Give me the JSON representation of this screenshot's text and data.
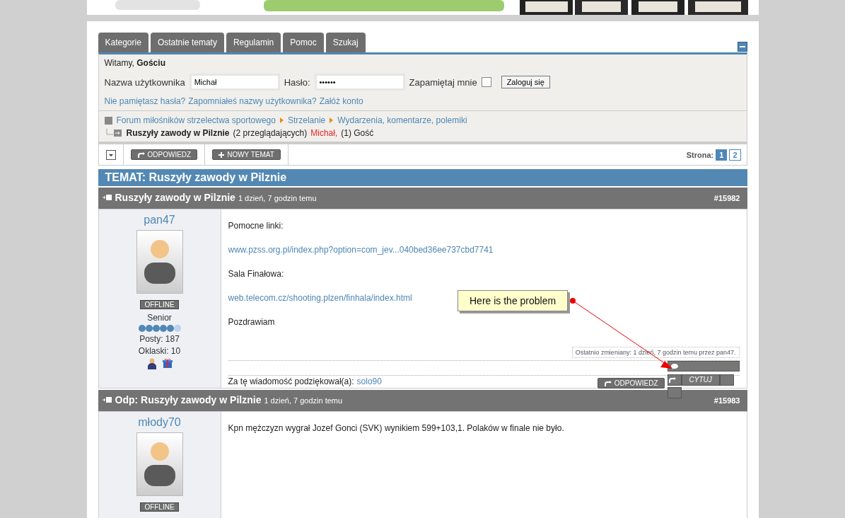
{
  "tabs": [
    {
      "label": "Kategorie"
    },
    {
      "label": "Ostatnie tematy"
    },
    {
      "label": "Regulamin"
    },
    {
      "label": "Pomoc"
    },
    {
      "label": "Szukaj"
    }
  ],
  "login": {
    "greeting": "Witamy, **Gościu**",
    "username_label": "Nazwa użytkownika",
    "username": "Michał",
    "password_label": "Hasło:",
    "password": "••••••",
    "remember_label": "Zapamiętaj mnie",
    "remember": false,
    "submit": "Zaloguj się",
    "links": [
      {
        "label": "Nie pamiętasz hasła?"
      },
      {
        "label": "Zapomniałeś nazwy użytkownika?"
      },
      {
        "label": "Załóż konto"
      }
    ]
  },
  "breadcrumb": [
    "Forum miłośników strzelectwa sportowego",
    "Strzelanie",
    "Wydarzenia, komentarze, polemiki"
  ],
  "current_topic": {
    "title": "Ruszyły zawody w Pilznie",
    "viewers": "(2 przeglądających)",
    "user": "Michał,",
    "guests": "(1) Gość"
  },
  "toolbar": {
    "reply": "ODPOWIEDZ",
    "new_topic": "NOWY TEMAT",
    "page_label": "Strona:",
    "pages": [
      {
        "label": "1",
        "selected": true
      },
      {
        "label": "2",
        "selected": false
      }
    ]
  },
  "topic_title": "TEMAT: Ruszyły zawody w Pilznie",
  "posts": [
    {
      "title": "Ruszyły zawody w Pilznie",
      "time": "1 dzień, 7 godzin temu",
      "number": "#15982",
      "author": "pan47",
      "status": "OFFLINE",
      "rank": "Senior",
      "stars": 5,
      "posts": "Posty: 187",
      "claps": "Oklaski: 10",
      "content": [
        {
          "kind": "text",
          "text": "Pomocne linki:"
        },
        {
          "kind": "link",
          "text": "www.pzss.org.pl/index.php?option=com_jev...040bed36ee737cbd7741"
        },
        {
          "kind": "text",
          "text": "Sala Finałowa:"
        },
        {
          "kind": "link",
          "text": "web.telecom.cz/shooting.plzen/finhala/index.html"
        },
        {
          "kind": "text",
          "text": "Pozdrawiam"
        }
      ],
      "edited": "Ostatnio zmieniany: 1 dzień, 7 godzin temu przez pan47.",
      "thanks_label": "Za tę wiadomość podziękował(a):",
      "thanks_user": "solo90",
      "reply": "ODPOWIEDZ",
      "broken_label": "CYTUJ"
    },
    {
      "title": "Odp: Ruszyły zawody w Pilznie",
      "time": "1 dzień, 7 godzin temu",
      "number": "#15983",
      "author": "młody70",
      "status": "OFFLINE",
      "content": [
        {
          "kind": "text",
          "text": "Kpn mężczyzn wygrał Jozef Gonci (SVK) wynikiem 599+103,1. Polaków w finale nie było."
        }
      ]
    }
  ],
  "annotation": {
    "text": "Here is the problem"
  }
}
